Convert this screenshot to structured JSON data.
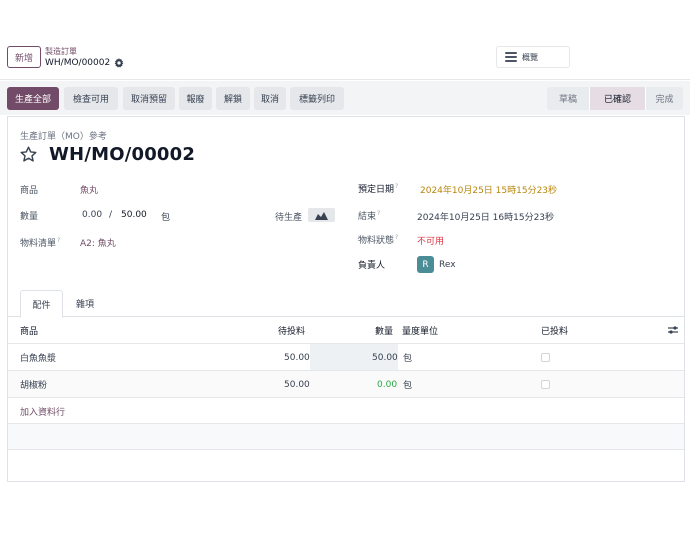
{
  "control_panel": {
    "new_button": "新增",
    "breadcrumb_parent": "製造訂單",
    "breadcrumb_current": "WH/MO/00002",
    "view_label": "概覽"
  },
  "actions": {
    "produce_all": "生產全部",
    "check_availability": "檢查可用",
    "unreserve": "取消預留",
    "scrap": "報廢",
    "unlock": "解鎖",
    "cancel": "取消",
    "print_labels": "標籤列印"
  },
  "status_stages": {
    "draft": "草稿",
    "confirmed": "已確認",
    "done": "完成",
    "current": "已確認"
  },
  "form": {
    "reference_label": "生產訂單（MO）參考",
    "name": "WH/MO/00002",
    "product_label": "商品",
    "product_value": "魚丸",
    "quantity_label": "數量",
    "quantity_produced": "0.00",
    "quantity_separator": "/",
    "quantity_target": "50.00",
    "quantity_uom": "包",
    "forecast_label": "待生產",
    "bom_label": "物料清單",
    "bom_value": "A2: 魚丸",
    "scheduled_label": "預定日期",
    "scheduled_value": "2024年10月25日 15時15分23秒",
    "end_label": "結束",
    "end_value": "2024年10月25日 16時15分23秒",
    "component_status_label": "物料狀態",
    "component_status_value": "不可用",
    "responsible_label": "負責人",
    "responsible_initial": "R",
    "responsible_name": "Rex",
    "help_mark": "?"
  },
  "tabs": {
    "components": "配件",
    "misc": "雜項"
  },
  "table": {
    "headers": {
      "product": "商品",
      "to_consume": "待投料",
      "quantity": "數量",
      "uom": "量度單位",
      "consumed": "已投料"
    },
    "rows": [
      {
        "product": "白魚魚漿",
        "to_consume": "50.00",
        "quantity": "50.00",
        "uom": "包"
      },
      {
        "product": "胡椒粉",
        "to_consume": "50.00",
        "quantity": "0.00",
        "uom": "包"
      }
    ],
    "add_line": "加入資料行"
  },
  "colors": {
    "brand": "#714b67",
    "warning_date": "#b8860b",
    "danger": "#dc3545",
    "success": "#28a745",
    "avatar": "#4b8d96"
  }
}
